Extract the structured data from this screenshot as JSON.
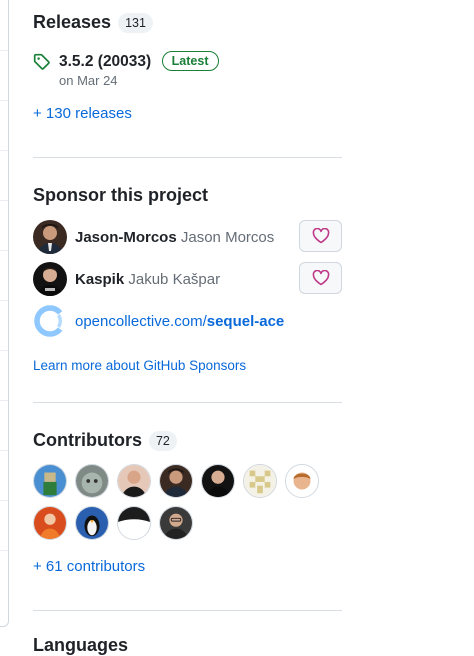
{
  "releases": {
    "title": "Releases",
    "count": "131",
    "latest": {
      "name": "3.5.2 (20033)",
      "badge": "Latest",
      "date": "on Mar 24"
    },
    "more_link": "+ 130 releases"
  },
  "sponsors": {
    "title": "Sponsor this project",
    "items": [
      {
        "login": "Jason-Morcos",
        "name": "Jason Morcos"
      },
      {
        "login": "Kaspik",
        "name": "Jakub Kašpar"
      }
    ],
    "opencollective": {
      "prefix": "opencollective.com/",
      "slug": "sequel-ace"
    },
    "learn_more": "Learn more about GitHub Sponsors"
  },
  "contributors": {
    "title": "Contributors",
    "count": "72",
    "more_link": "+ 61 contributors",
    "avatar_count": 11
  },
  "languages": {
    "title": "Languages"
  },
  "colors": {
    "link": "#0969da",
    "latest_green": "#1a7f37",
    "heart_pink": "#bf3989"
  }
}
